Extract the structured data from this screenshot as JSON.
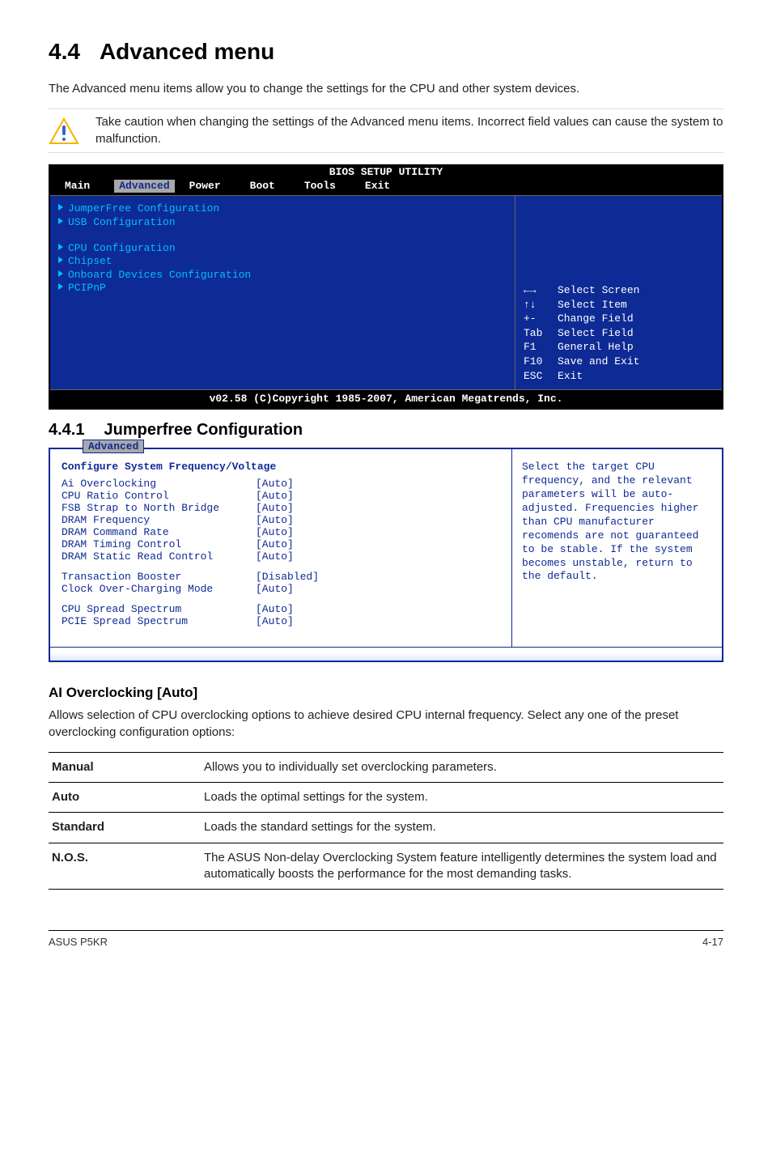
{
  "heading": {
    "number": "4.4",
    "title": "Advanced menu"
  },
  "intro": "The Advanced menu items allow you to change the settings for the CPU and other system devices.",
  "callout": "Take caution when changing the settings of the Advanced menu items. Incorrect field values can cause the system to malfunction.",
  "bios": {
    "title": "BIOS SETUP UTILITY",
    "menus": [
      "Main",
      "Advanced",
      "Power",
      "Boot",
      "Tools",
      "Exit"
    ],
    "selected_menu_index": 1,
    "left_items": [
      "JumperFree Configuration",
      "USB Configuration",
      "",
      "CPU Configuration",
      "Chipset",
      "Onboard Devices Configuration",
      "PCIPnP"
    ],
    "keys": [
      {
        "k": "←→",
        "d": "Select Screen"
      },
      {
        "k": "↑↓",
        "d": "Select Item"
      },
      {
        "k": "+-",
        "d": "Change Field"
      },
      {
        "k": "Tab",
        "d": "Select Field"
      },
      {
        "k": "F1",
        "d": "General Help"
      },
      {
        "k": "F10",
        "d": "Save and Exit"
      },
      {
        "k": "ESC",
        "d": "Exit"
      }
    ],
    "footer": "v02.58 (C)Copyright 1985-2007, American Megatrends, Inc."
  },
  "sub": {
    "number": "4.4.1",
    "title": "Jumperfree Configuration"
  },
  "adv": {
    "tab": "Advanced",
    "header": "Configure System Frequency/Voltage",
    "rows": [
      {
        "l": "Ai Overclocking",
        "v": "[Auto]"
      },
      {
        "l": "CPU Ratio Control",
        "v": "[Auto]"
      },
      {
        "l": "FSB Strap to North Bridge",
        "v": "[Auto]"
      },
      {
        "l": "DRAM Frequency",
        "v": "[Auto]"
      },
      {
        "l": "DRAM Command Rate",
        "v": "[Auto]"
      },
      {
        "l": "DRAM Timing Control",
        "v": "[Auto]"
      },
      {
        "l": "DRAM Static Read Control",
        "v": "[Auto]"
      }
    ],
    "rows2": [
      {
        "l": "Transaction Booster",
        "v": "[Disabled]"
      },
      {
        "l": "Clock Over-Charging Mode",
        "v": "[Auto]"
      }
    ],
    "rows3": [
      {
        "l": "CPU Spread Spectrum",
        "v": "[Auto]"
      },
      {
        "l": "PCIE Spread Spectrum",
        "v": "[Auto]"
      }
    ],
    "help": "Select the target CPU frequency, and the relevant parameters will be auto-adjusted. Frequencies higher than CPU manufacturer recomends are not guaranteed to be stable. If the system becomes unstable, return to the default."
  },
  "ai": {
    "heading": "AI Overclocking [Auto]",
    "desc": "Allows selection of CPU overclocking options to achieve desired CPU internal frequency. Select any one of the preset overclocking configuration options:"
  },
  "options": [
    {
      "k": "Manual",
      "d": "Allows you to individually set overclocking parameters."
    },
    {
      "k": "Auto",
      "d": "Loads the optimal settings for the system."
    },
    {
      "k": "Standard",
      "d": "Loads the standard settings for the system."
    },
    {
      "k": "N.O.S.",
      "d": "The ASUS Non-delay Overclocking System feature intelligently determines the system load and automatically boosts the performance for the most demanding tasks."
    }
  ],
  "footer": {
    "left": "ASUS P5KR",
    "right": "4-17"
  }
}
